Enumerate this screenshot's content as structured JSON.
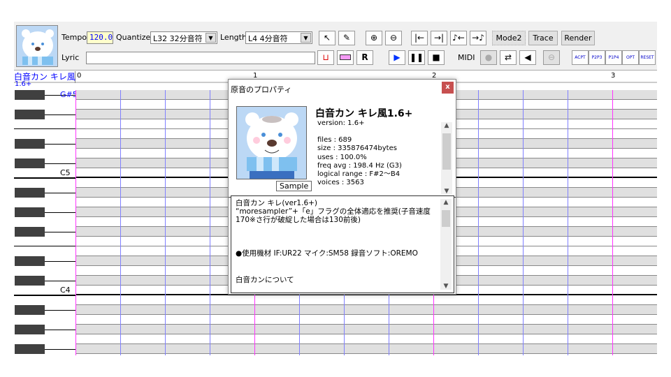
{
  "toolbar": {
    "tempo_label": "Tempo",
    "tempo_value": "120.0",
    "quantize_label": "Quantize",
    "quantize_value": "L32 32分音符",
    "length_label": "Length",
    "length_value": "L4  4分音符",
    "lyric_label": "Lyric",
    "lyric_value": "",
    "mode2": "Mode2",
    "trace": "Trace",
    "render": "Render",
    "midi_label": "MIDI",
    "icons": [
      "pointer",
      "pencil",
      "zoom-in",
      "zoom-out",
      "go-start",
      "go-end",
      "note-shrink",
      "note-extend"
    ],
    "flag_buttons": [
      "ACPT",
      "P2P3",
      "P1P4",
      "OPT",
      "RESET"
    ]
  },
  "track": {
    "name": "白音カン キレ風",
    "version": "1.6+"
  },
  "ruler": [
    "0",
    "1",
    "2",
    "3"
  ],
  "keys": {
    "top_label": "G#5",
    "c5": "C5",
    "c4": "C4"
  },
  "dialog": {
    "title": "原音のプロパティ",
    "close": "x",
    "name": "白音カン キレ風1.6+",
    "sample_button": "Sample",
    "info": [
      "version: 1.6+",
      "",
      "files : 689",
      "size :  335876474bytes",
      "uses : 100.0%",
      "freq avg : 198.4 Hz (G3)",
      "logical range : F#2～B4",
      "voices : 3563"
    ],
    "readme": [
      "白音カン キレ(ver1.6+)",
      "“moresampler”+「e」フラグの全体適応を推奨(子音速度170※さ行が破綻した場合は130前後)",
      "",
      "",
      "●使用機材  IF:UR22  マイク:SM58  録音ソフト:OREMO",
      "",
      "白音カンについて"
    ]
  },
  "colors": {
    "accent": "#0000ff",
    "measure": "#ff33ff",
    "beat": "#8080ff",
    "close": "#c75050"
  }
}
